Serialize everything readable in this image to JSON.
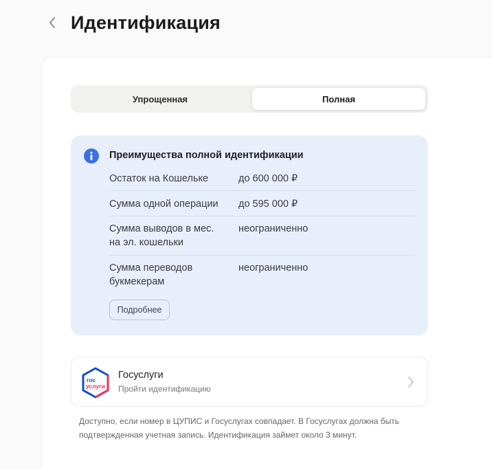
{
  "header": {
    "title": "Идентификация",
    "back_icon": "chevron-left-icon"
  },
  "tabs": [
    {
      "label": "Упрощенная",
      "active": false
    },
    {
      "label": "Полная",
      "active": true
    }
  ],
  "info": {
    "icon": "info-icon",
    "title": "Преимущества полной идентификации",
    "rows": [
      {
        "label": "Остаток на Кошельке",
        "value": "до 600 000 ₽"
      },
      {
        "label": "Сумма одной операции",
        "value": "до 595 000 ₽"
      },
      {
        "label": "Сумма выводов в мес. на эл. кошельки",
        "value": "неограниченно"
      },
      {
        "label": "Сумма переводов букмекерам",
        "value": "неограниченно"
      }
    ],
    "more_button": "Подробнее"
  },
  "gosuslugi": {
    "logo_icon": "gosuslugi-logo-icon",
    "logo_text_top": "гос",
    "logo_text_bottom": "услуги",
    "title": "Госуслуги",
    "subtitle": "Пройти идентификацию",
    "chevron_icon": "chevron-right-icon"
  },
  "note": "Доступно, если номер в ЦУПИС и Госуслугах совпадает. В Госуслугах должна быть подтвержденная учетная запись. Идентификация займет около 3 минут.",
  "colors": {
    "info_bg": "#e8effb",
    "info_icon": "#3f6fe0",
    "logo_blue": "#0d4cd3",
    "logo_red": "#ee2f53"
  }
}
